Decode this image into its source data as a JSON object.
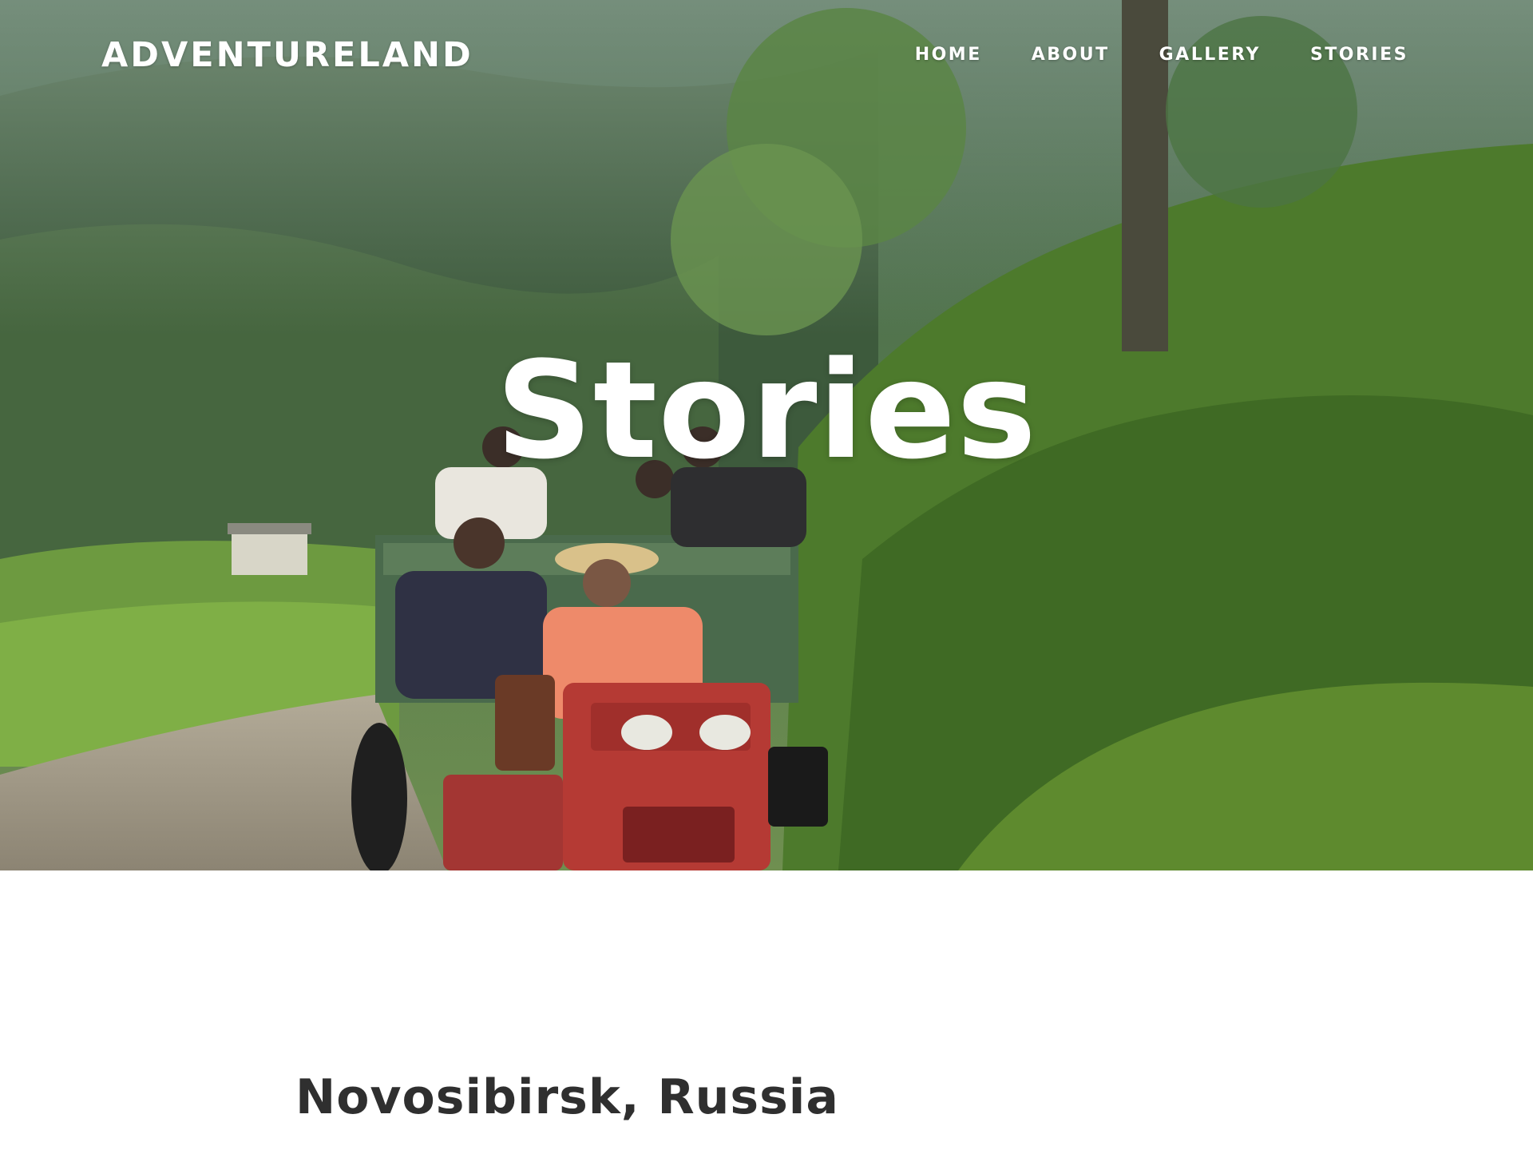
{
  "header": {
    "brand": "ADVENTURELAND",
    "nav": [
      {
        "label": "HOME"
      },
      {
        "label": "ABOUT"
      },
      {
        "label": "GALLERY"
      },
      {
        "label": "STORIES"
      }
    ]
  },
  "hero": {
    "title": "Stories",
    "image": "photo of people riding a red tractor-trailer down a dirt road through green mountains"
  },
  "main": {
    "story_heading": "Novosibirsk, Russia"
  },
  "colors": {
    "text_on_hero": "#ffffff",
    "heading_text": "#2f2f2f",
    "background": "#ffffff"
  }
}
